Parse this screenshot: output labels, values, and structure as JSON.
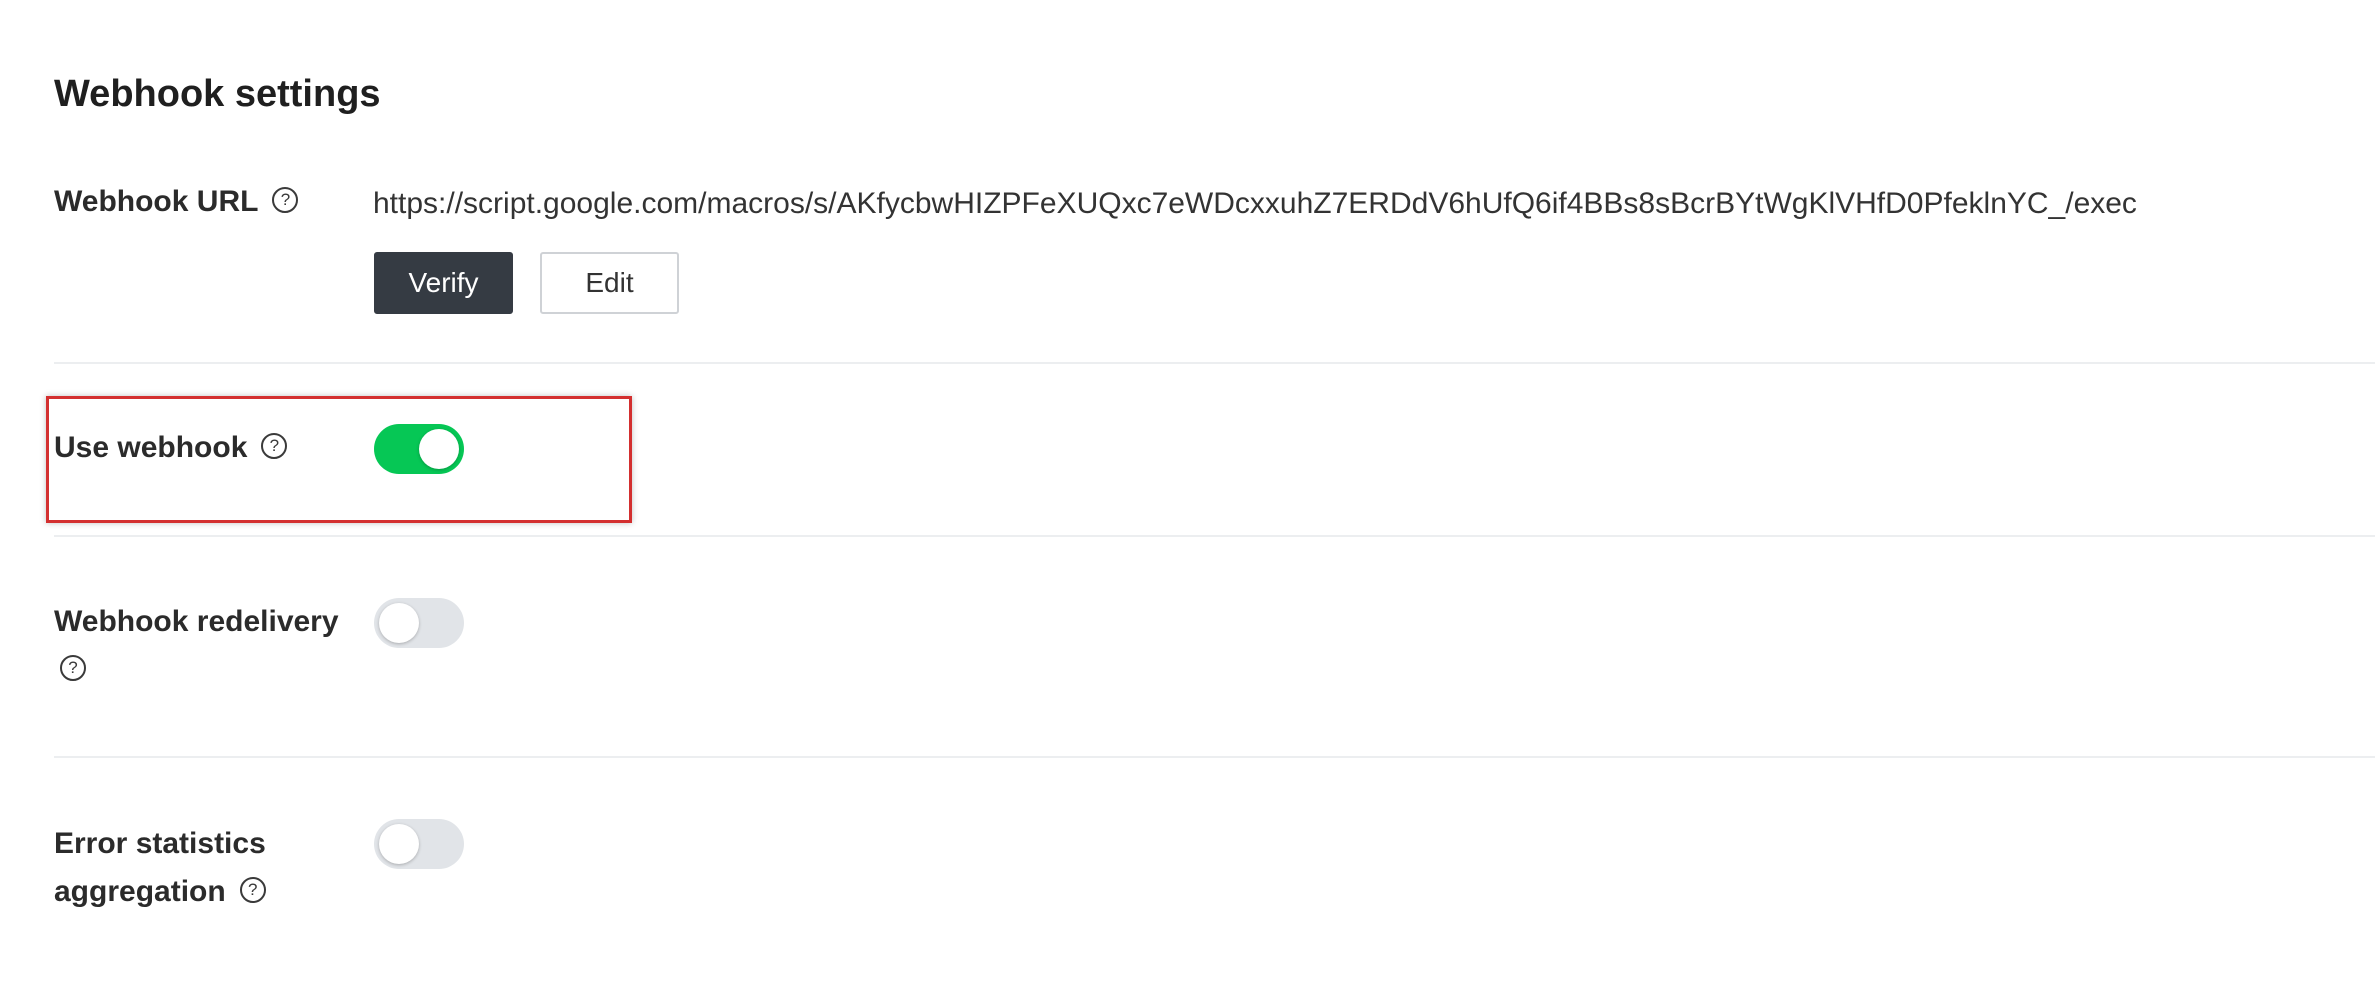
{
  "page": {
    "title": "Webhook settings"
  },
  "webhook_url": {
    "label": "Webhook URL",
    "help_icon": "?",
    "value": "https://script.google.com/macros/s/AKfycbwHIZPFeXUQxc7eWDcxxuhZ7ERDdV6hUfQ6if4BBs8sBcrBYtWgKlVHfD0PfeklnYC_/exec",
    "verify_label": "Verify",
    "edit_label": "Edit"
  },
  "use_webhook": {
    "label": "Use webhook",
    "help_icon": "?",
    "enabled": true
  },
  "webhook_redelivery": {
    "label": "Webhook redelivery",
    "help_icon": "?",
    "enabled": false
  },
  "error_stats": {
    "label_line1": "Error statistics",
    "label_line2": "aggregation",
    "help_icon": "?",
    "enabled": false
  },
  "colors": {
    "toggle_on": "#06c755",
    "toggle_off": "#e1e4e8",
    "primary_button": "#353b43",
    "highlight": "#d32f2f"
  },
  "icons": {
    "help": "question-circle-icon"
  }
}
